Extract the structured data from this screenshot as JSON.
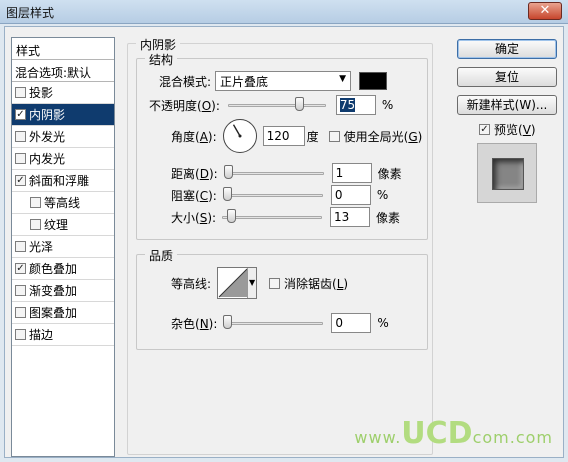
{
  "window": {
    "title": "图层样式",
    "close_glyph": "✕"
  },
  "style_list": {
    "header": "样式",
    "blend_options": "混合选项:默认",
    "items": [
      {
        "label": "投影",
        "checked": false,
        "indent": false,
        "selected": false
      },
      {
        "label": "内阴影",
        "checked": true,
        "indent": false,
        "selected": true
      },
      {
        "label": "外发光",
        "checked": false,
        "indent": false,
        "selected": false
      },
      {
        "label": "内发光",
        "checked": false,
        "indent": false,
        "selected": false
      },
      {
        "label": "斜面和浮雕",
        "checked": true,
        "indent": false,
        "selected": false
      },
      {
        "label": "等高线",
        "checked": false,
        "indent": true,
        "selected": false
      },
      {
        "label": "纹理",
        "checked": false,
        "indent": true,
        "selected": false
      },
      {
        "label": "光泽",
        "checked": false,
        "indent": false,
        "selected": false
      },
      {
        "label": "颜色叠加",
        "checked": true,
        "indent": false,
        "selected": false
      },
      {
        "label": "渐变叠加",
        "checked": false,
        "indent": false,
        "selected": false
      },
      {
        "label": "图案叠加",
        "checked": false,
        "indent": false,
        "selected": false
      },
      {
        "label": "描边",
        "checked": false,
        "indent": false,
        "selected": false
      }
    ]
  },
  "inner_shadow": {
    "section_title": "内阴影",
    "structure": {
      "title": "结构",
      "blend_mode_label": "混合模式:",
      "blend_mode_value": "正片叠底",
      "shadow_color": "#000000",
      "opacity_label": "不透明度(",
      "opacity_key": "O",
      "opacity_label_end": "):",
      "opacity_value": "75",
      "opacity_fraction": 0.75,
      "percent": "%",
      "angle_label": "角度(",
      "angle_key": "A",
      "angle_label_end": "):",
      "angle_value": "120",
      "angle_unit": "度",
      "global_light_label": "使用全局光(",
      "global_light_key": "G",
      "global_light_end": ")",
      "global_light_checked": false,
      "distance_label": "距离(",
      "distance_key": "D",
      "distance_end": "):",
      "distance_value": "1",
      "distance_fraction": 0.0,
      "px_unit": "像素",
      "choke_label": "阻塞(",
      "choke_key": "C",
      "choke_end": "):",
      "choke_value": "0",
      "choke_fraction": 0.0,
      "size_label": "大小(",
      "size_key": "S",
      "size_end": "):",
      "size_value": "13",
      "size_fraction": 0.06
    },
    "quality": {
      "title": "品质",
      "contour_label": "等高线:",
      "antialias_label": "消除锯齿(",
      "antialias_key": "L",
      "antialias_end": ")",
      "antialias_checked": false,
      "noise_label": "杂色(",
      "noise_key": "N",
      "noise_end": "):",
      "noise_value": "0",
      "noise_fraction": 0.0
    }
  },
  "buttons": {
    "ok": "确定",
    "reset": "复位",
    "new_style": "新建样式(W)...",
    "preview_label": "预览(",
    "preview_key": "V",
    "preview_end": ")",
    "preview_checked": true
  },
  "watermark": {
    "big": "UCD",
    "small_left": "www.",
    "small_right": "com.com"
  }
}
